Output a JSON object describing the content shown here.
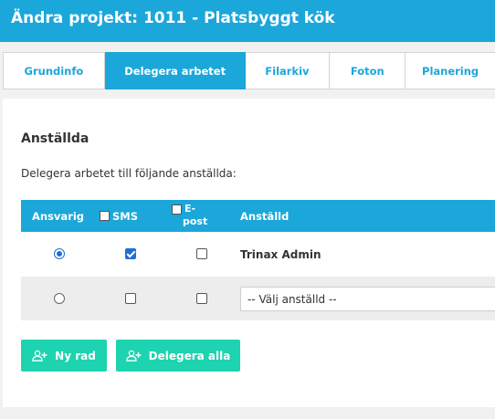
{
  "header": {
    "title": "Ändra projekt: 1011 - Platsbyggt kök"
  },
  "tabs": [
    {
      "label": "Grundinfo",
      "active": false
    },
    {
      "label": "Delegera arbetet",
      "active": true
    },
    {
      "label": "Filarkiv",
      "active": false
    },
    {
      "label": "Foton",
      "active": false
    },
    {
      "label": "Planering",
      "active": false
    }
  ],
  "section": {
    "title": "Anställda",
    "description": "Delegera arbetet till följande anställda:"
  },
  "table": {
    "headers": {
      "responsible": "Ansvarig",
      "sms": "SMS",
      "email_line1": "E-",
      "email_line2": "post",
      "employee": "Anställd"
    },
    "rows": [
      {
        "responsible": true,
        "sms": true,
        "email": false,
        "employee": "Trinax Admin"
      },
      {
        "responsible": false,
        "sms": false,
        "email": false,
        "employee_select": "-- Välj anställd --"
      }
    ]
  },
  "buttons": {
    "new_row": "Ny rad",
    "delegate_all": "Delegera alla"
  },
  "colors": {
    "primary": "#1ba7d9",
    "action": "#1dd3b0",
    "checked": "#1f6fd6"
  },
  "icons": {
    "add_user": "add-user-icon"
  }
}
